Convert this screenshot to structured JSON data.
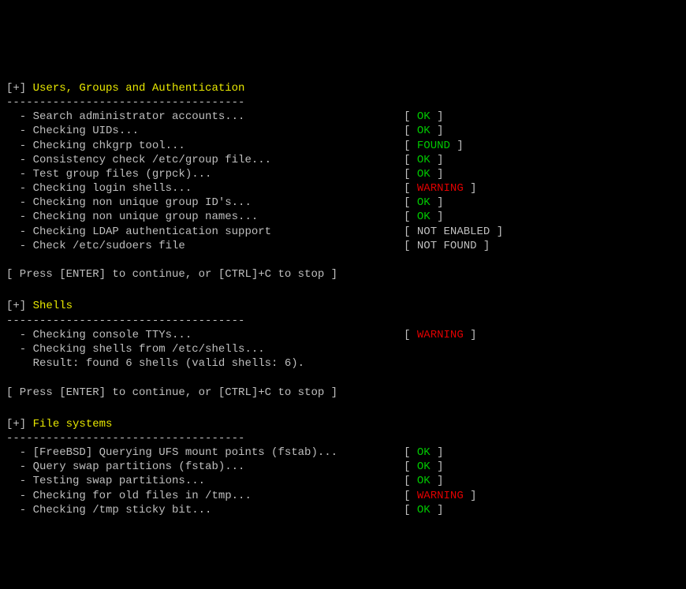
{
  "symbols": {
    "header_prefix": "[+] ",
    "divider": "------------------------------------",
    "item_prefix": "  - ",
    "result_prefix": "    ",
    "bracket_open": "[ ",
    "bracket_close": " ]"
  },
  "prompts": {
    "continue": "[ Press [ENTER] to continue, or [CTRL]+C to stop ]"
  },
  "sections": [
    {
      "title": "Users, Groups and Authentication",
      "items": [
        {
          "label": "Search administrator accounts...",
          "status": "OK",
          "status_class": "status-ok"
        },
        {
          "label": "Checking UIDs...",
          "status": "OK",
          "status_class": "status-ok"
        },
        {
          "label": "Checking chkgrp tool...",
          "status": "FOUND",
          "status_class": "status-found"
        },
        {
          "label": "Consistency check /etc/group file...",
          "status": "OK",
          "status_class": "status-ok"
        },
        {
          "label": "Test group files (grpck)...",
          "status": "OK",
          "status_class": "status-ok"
        },
        {
          "label": "Checking login shells...",
          "status": "WARNING",
          "status_class": "status-warning"
        },
        {
          "label": "Checking non unique group ID's...",
          "status": "OK",
          "status_class": "status-ok"
        },
        {
          "label": "Checking non unique group names...",
          "status": "OK",
          "status_class": "status-ok"
        },
        {
          "label": "Checking LDAP authentication support",
          "status": "NOT ENABLED",
          "status_class": "status-notenabled"
        },
        {
          "label": "Check /etc/sudoers file",
          "status": "NOT FOUND",
          "status_class": "status-notfound"
        }
      ],
      "extra_lines": [],
      "show_prompt": true
    },
    {
      "title": "Shells",
      "items": [
        {
          "label": "Checking console TTYs...",
          "status": "WARNING",
          "status_class": "status-warning"
        },
        {
          "label": "Checking shells from /etc/shells...",
          "status": null,
          "status_class": ""
        }
      ],
      "extra_lines": [
        "Result: found 6 shells (valid shells: 6)."
      ],
      "show_prompt": true
    },
    {
      "title": "File systems",
      "items": [
        {
          "label": "[FreeBSD] Querying UFS mount points (fstab)...",
          "status": "OK",
          "status_class": "status-ok"
        },
        {
          "label": "Query swap partitions (fstab)...",
          "status": "OK",
          "status_class": "status-ok"
        },
        {
          "label": "Testing swap partitions...",
          "status": "OK",
          "status_class": "status-ok"
        },
        {
          "label": "Checking for old files in /tmp...",
          "status": "WARNING",
          "status_class": "status-warning"
        },
        {
          "label": "Checking /tmp sticky bit...",
          "status": "OK",
          "status_class": "status-ok"
        }
      ],
      "extra_lines": [],
      "show_prompt": false
    }
  ],
  "layout": {
    "label_width_chars": 60
  }
}
